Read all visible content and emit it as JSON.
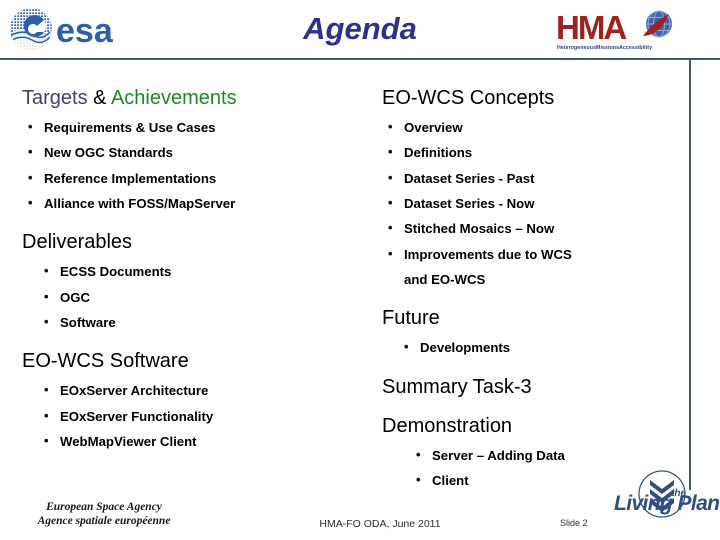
{
  "header": {
    "title": "Agenda",
    "title_color": "#2c3190",
    "esa_logo_text": "esa",
    "hma_logo_text": "HMA",
    "hma_logo_subtitle": "HeterogeneousMissionsAccessibility",
    "hma_color": "#9e2320"
  },
  "left_column": [
    {
      "heading_parts": [
        {
          "text": "Targets",
          "color": "#3b3f7d"
        },
        {
          "text": " & ",
          "color": "#000000"
        },
        {
          "text": "Achievements",
          "color": "#1a8b22"
        }
      ],
      "heading_plain": "Targets & Achievements",
      "bullets": [
        "Requirements & Use Cases",
        "New OGC Standards",
        "Reference Implementations",
        "Alliance with FOSS/MapServer"
      ],
      "indent": 0
    },
    {
      "heading_plain": "Deliverables",
      "bullets": [
        "ECSS Documents",
        "OGC",
        "Software"
      ],
      "indent": 1
    },
    {
      "heading_plain": "EO-WCS Software",
      "bullets": [
        "EOxServer Architecture",
        "EOxServer Functionality",
        "WebMapViewer Client"
      ],
      "indent": 1
    }
  ],
  "right_column": [
    {
      "heading_plain": "EO-WCS Concepts",
      "bullets": [
        "Overview",
        "Definitions",
        "Dataset Series - Past",
        "Dataset Series - Now",
        "Stitched Mosaics – Now",
        "Improvements due to WCS\nand EO-WCS"
      ],
      "indent": 0
    },
    {
      "heading_plain": "Future",
      "bullets": [
        "Developments"
      ],
      "indent": 1
    },
    {
      "heading_plain": "Summary Task-3",
      "bullets": [],
      "indent": 0
    },
    {
      "heading_plain": "Demonstration",
      "bullets": [
        "Server – Adding Data",
        "Client"
      ],
      "indent": 2
    }
  ],
  "footer": {
    "agency_line1": "European Space Agency",
    "agency_line2": "Agence spatiale européenne",
    "center_text": "HMA-FO ODA, June 2011",
    "slide_label": "Slide 2",
    "living_planet_the": "the",
    "living_planet_text": "Living Planet",
    "living_planet_color": "#2f4f82"
  }
}
